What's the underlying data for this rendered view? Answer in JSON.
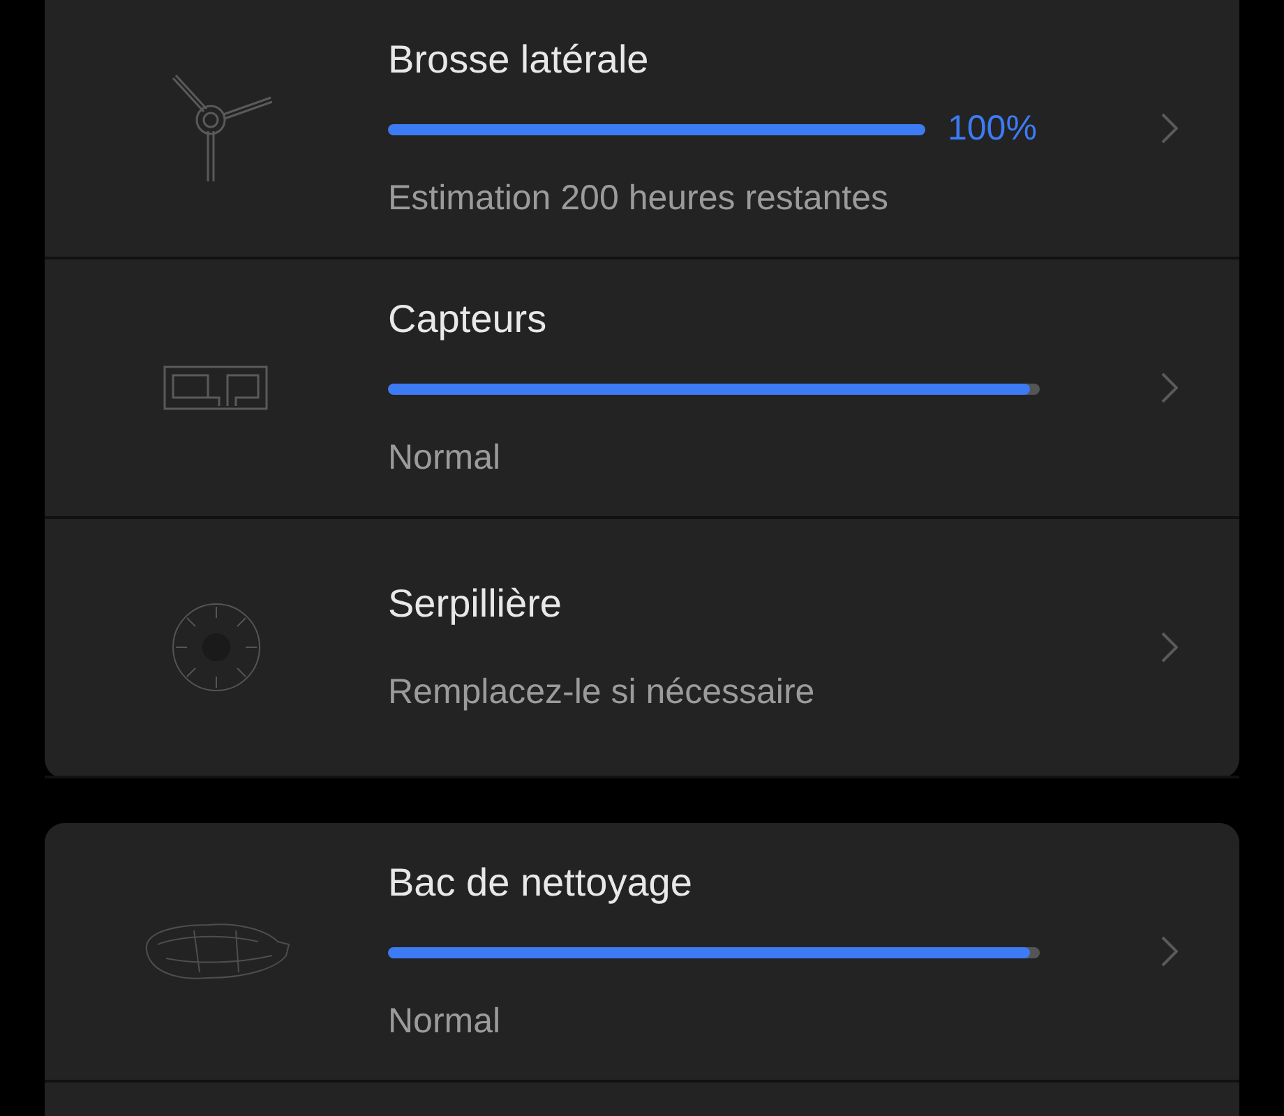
{
  "sections": [
    {
      "items": [
        {
          "kind": "progress",
          "title": "Brosse latérale",
          "level": 1,
          "reading": "100%",
          "subtitle": "Estimation 200 heures restantes"
        },
        {
          "kind": "progress",
          "title": "Capteurs",
          "level": 0.985,
          "subtitle": "Normal"
        },
        {
          "kind": "text",
          "title": "Serpillière",
          "subtitle": "Remplacez-le si nécessaire"
        }
      ]
    },
    {
      "items": [
        {
          "kind": "progress",
          "title": "Bac de nettoyage",
          "level": 0.985,
          "subtitle": "Normal"
        }
      ]
    }
  ]
}
